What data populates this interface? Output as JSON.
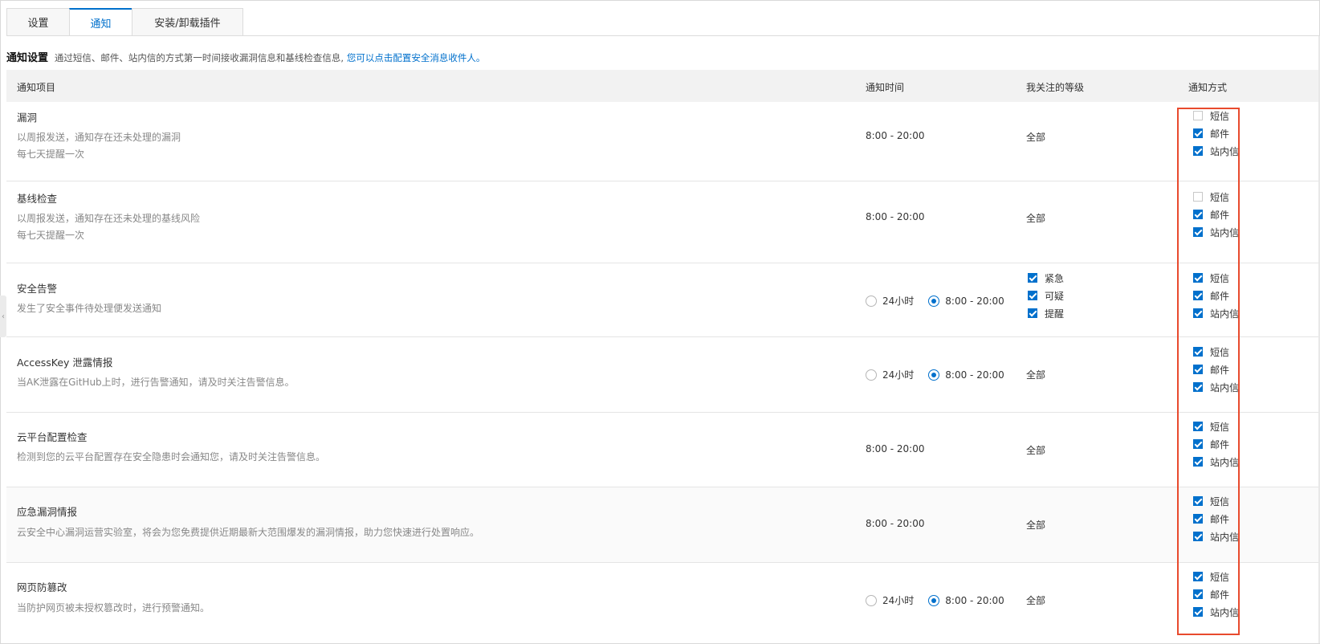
{
  "tabs": [
    {
      "label": "设置",
      "active": false
    },
    {
      "label": "通知",
      "active": true
    },
    {
      "label": "安装/卸载插件",
      "active": false
    }
  ],
  "section": {
    "title": "通知设置",
    "description": "通过短信、邮件、站内信的方式第一时间接收漏洞信息和基线检查信息,",
    "link": "您可以点击配置安全消息收件人。"
  },
  "table": {
    "columns": [
      "通知项目",
      "通知时间",
      "我关注的等级",
      "通知方式"
    ],
    "method_labels": [
      "短信",
      "邮件",
      "站内信"
    ],
    "rows": [
      {
        "title": "漏洞",
        "desc_lines": [
          "以周报发送，通知存在还未处理的漏洞",
          "每七天提醒一次"
        ],
        "time": "8:00 - 20:00",
        "level": "全部",
        "methods": [
          false,
          true,
          true
        ]
      },
      {
        "title": "基线检查",
        "desc_lines": [
          "以周报发送，通知存在还未处理的基线风险",
          "每七天提醒一次"
        ],
        "time": "8:00 - 20:00",
        "level": "全部",
        "methods": [
          false,
          true,
          true
        ]
      },
      {
        "title": "安全告警",
        "desc_lines": [
          "发生了安全事件待处理便发送通知"
        ],
        "time_options": [
          "24小时",
          "8:00 - 20:00"
        ],
        "time_selected": 1,
        "levels": [
          {
            "label": "紧急",
            "checked": true
          },
          {
            "label": "可疑",
            "checked": true
          },
          {
            "label": "提醒",
            "checked": true
          }
        ],
        "methods": [
          true,
          true,
          true
        ]
      },
      {
        "title": "AccessKey 泄露情报",
        "desc_lines": [
          "当AK泄露在GitHub上时，进行告警通知，请及时关注告警信息。"
        ],
        "time_options": [
          "24小时",
          "8:00 - 20:00"
        ],
        "time_selected": 1,
        "level": "全部",
        "methods": [
          true,
          true,
          true
        ]
      },
      {
        "title": "云平台配置检查",
        "desc_lines": [
          "检测到您的云平台配置存在安全隐患时会通知您，请及时关注告警信息。"
        ],
        "time": "8:00 - 20:00",
        "level": "全部",
        "methods": [
          true,
          true,
          true
        ]
      },
      {
        "title": "应急漏洞情报",
        "desc_lines": [
          "云安全中心漏洞运营实验室，将会为您免费提供近期最新大范围爆发的漏洞情报，助力您快速进行处置响应。"
        ],
        "time": "8:00 - 20:00",
        "level": "全部",
        "methods": [
          true,
          true,
          true
        ]
      },
      {
        "title": "网页防篡改",
        "desc_lines": [
          "当防护网页被未授权篡改时，进行预警通知。"
        ],
        "time_options": [
          "24小时",
          "8:00 - 20:00"
        ],
        "time_selected": 1,
        "level": "全部",
        "methods": [
          true,
          true,
          true
        ]
      }
    ]
  },
  "colors": {
    "accent": "#0070cc",
    "highlight_box": "#e84a2d",
    "header_bg": "#f2f2f2"
  },
  "icons": {
    "left_handle": "chevron-left-icon"
  }
}
